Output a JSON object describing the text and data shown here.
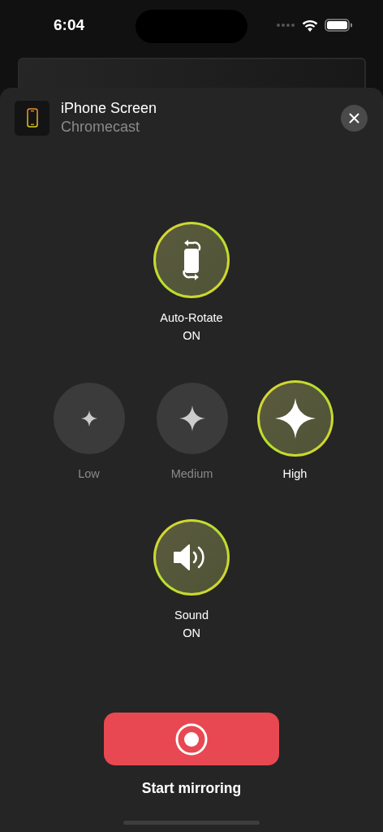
{
  "status_bar": {
    "time": "6:04"
  },
  "header": {
    "title": "iPhone Screen",
    "subtitle": "Chromecast"
  },
  "auto_rotate": {
    "label": "Auto-Rotate",
    "state": "ON",
    "on": true
  },
  "quality": [
    {
      "label": "Low",
      "selected": false,
      "kind": "low"
    },
    {
      "label": "Medium",
      "selected": false,
      "kind": "medium"
    },
    {
      "label": "High",
      "selected": true,
      "kind": "high"
    }
  ],
  "sound": {
    "label": "Sound",
    "state": "ON",
    "on": true
  },
  "start_button": {
    "label": "Start mirroring"
  }
}
